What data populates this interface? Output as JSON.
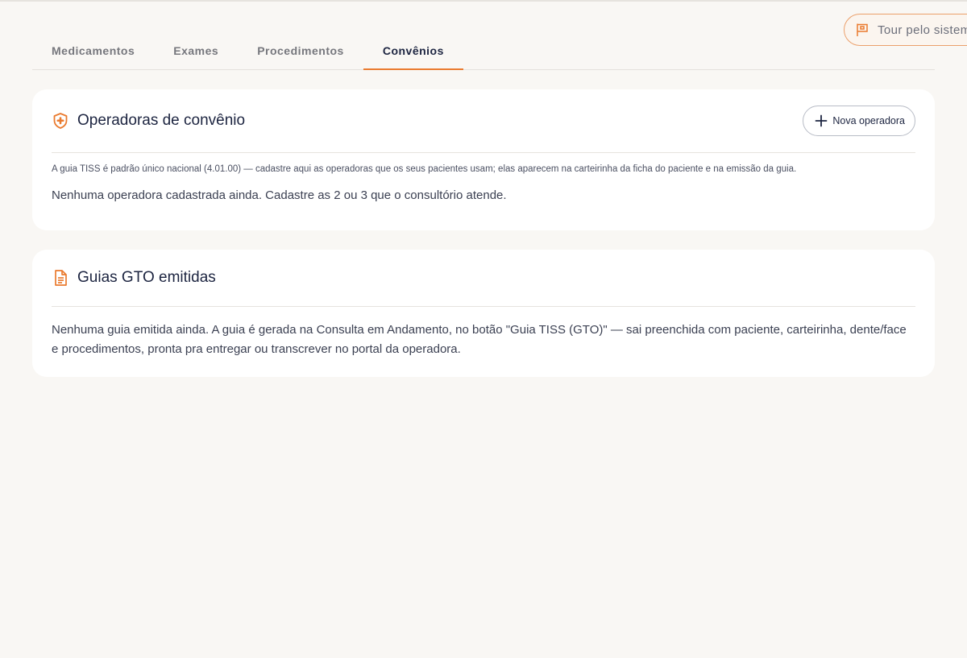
{
  "tour": {
    "label": "Tour pelo sistema",
    "icon": "flag-icon"
  },
  "tabs": [
    {
      "label": "Medicamentos",
      "active": false
    },
    {
      "label": "Exames",
      "active": false
    },
    {
      "label": "Procedimentos",
      "active": false
    },
    {
      "label": "Convênios",
      "active": true
    }
  ],
  "operadoras": {
    "icon": "shield-plus-icon",
    "title": "Operadoras de convênio",
    "new_button": "Nova operadora",
    "hint": "A guia TISS é padrão único nacional (4.01.00) — cadastre aqui as operadoras que os seus pacientes usam; elas aparecem na carteirinha da ficha do paciente e na emissão da guia.",
    "empty": "Nenhuma operadora cadastrada ainda. Cadastre as 2 ou 3 que o consultório atende."
  },
  "guias": {
    "icon": "document-icon",
    "title": "Guias GTO emitidas",
    "empty": "Nenhuma guia emitida ainda. A guia é gerada na Consulta em Andamento, no botão \"Guia TISS (GTO)\" — sai preenchida com paciente, carteirinha, dente/face e procedimentos, pronta pra entregar ou transcrever no portal da operadora."
  },
  "colors": {
    "accent": "#ea7a2e",
    "text": "#1c2440",
    "background": "#f9f7f4"
  }
}
